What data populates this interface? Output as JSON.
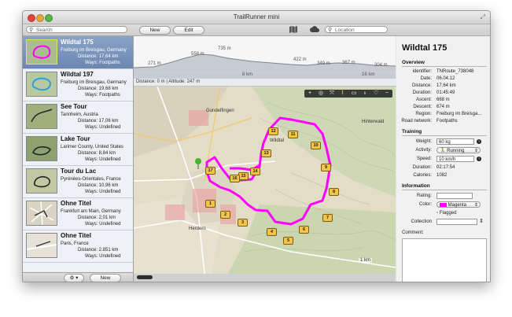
{
  "window": {
    "title": "TrailRunner mini"
  },
  "toolbar": {
    "new_label": "New",
    "edit_label": "Edit",
    "search_placeholder": "Search",
    "location_placeholder": "Location",
    "map_icon": "map-icon",
    "cloud_icon": "cloud-icon"
  },
  "sidebar": {
    "tours": [
      {
        "name": "Wildtal 175",
        "place": "Freiburg im Breisgau, Germany",
        "distance": "Distance: 17,64 km",
        "ways": "Ways: Footpaths",
        "selected": true
      },
      {
        "name": "Wildtal 197",
        "place": "Freiburg im Breisgau, Germany",
        "distance": "Distance: 19,68 km",
        "ways": "Ways: Footpaths"
      },
      {
        "name": "See Tour",
        "place": "Tannheim, Austria",
        "distance": "Distance: 17,06 km",
        "ways": "Ways: Undefined"
      },
      {
        "name": "Lake Tour",
        "place": "Larimer County, United States",
        "distance": "Distance: 8,84 km",
        "ways": "Ways: Undefined"
      },
      {
        "name": "Tour du Lac",
        "place": "Pyrénées-Orientales, France",
        "distance": "Distance: 10,96 km",
        "ways": "Ways: Undefined"
      },
      {
        "name": "Ohne Titel",
        "place": "Frankfurt am Main, Germany",
        "distance": "Distance: 2,01 km",
        "ways": "Ways: Undefined"
      },
      {
        "name": "Ohne Titel",
        "place": "Paris, France",
        "distance": "Distance: 2.851 km",
        "ways": "Ways: Undefined"
      }
    ],
    "bottom_new_label": "New",
    "gear_icon": "gear-icon"
  },
  "profile": {
    "labels": [
      "271 m",
      "558 m",
      "735 m",
      "422 m",
      "349 m",
      "367 m",
      "304 m"
    ],
    "km_labels": [
      "8 km",
      "16 km"
    ],
    "status": "Distance: 0 m | Altitude: 247 m"
  },
  "map": {
    "place_labels": [
      "Gundelfingen",
      "Wildtal",
      "Herdern",
      "Hinterwald"
    ],
    "waypoints": [
      "1",
      "2",
      "3",
      "4",
      "5",
      "6",
      "7",
      "8",
      "9",
      "10",
      "11",
      "12",
      "13",
      "14",
      "15",
      "16",
      "17"
    ],
    "route_color": "#ff00ff",
    "scale_label": "1 km"
  },
  "inspector": {
    "title": "Wildtal 175",
    "overview_header": "Overview",
    "overview": [
      {
        "label": "identifier:",
        "value": "TNRoute_738048"
      },
      {
        "label": "Date:",
        "value": "06.04.12"
      },
      {
        "label": "Distance:",
        "value": "17,64 km"
      },
      {
        "label": "Duration:",
        "value": "01:45:49"
      },
      {
        "label": "Ascent:",
        "value": "668 m"
      },
      {
        "label": "Descent:",
        "value": "674 m"
      },
      {
        "label": "Region:",
        "value": "Freiburg im Breisga..."
      },
      {
        "label": "Road network:",
        "value": "Footpaths"
      }
    ],
    "training_header": "Training",
    "weight_label": "Weight:",
    "weight_value": "60 kg",
    "activity_label": "Activity:",
    "activity_value": "Running",
    "speed_label": "Speed:",
    "speed_value": "10 km/h",
    "duration_label": "Duration:",
    "duration_value": "02:17:54",
    "calories_label": "Calories:",
    "calories_value": "1082",
    "information_header": "Information",
    "rating_label": "Rating:",
    "color_label": "Color:",
    "color_value": "Magenta",
    "color_swatch": "#ff00ff",
    "flagged_label": "Flagged",
    "collection_label": "Collection",
    "comment_label": "Comment:"
  }
}
